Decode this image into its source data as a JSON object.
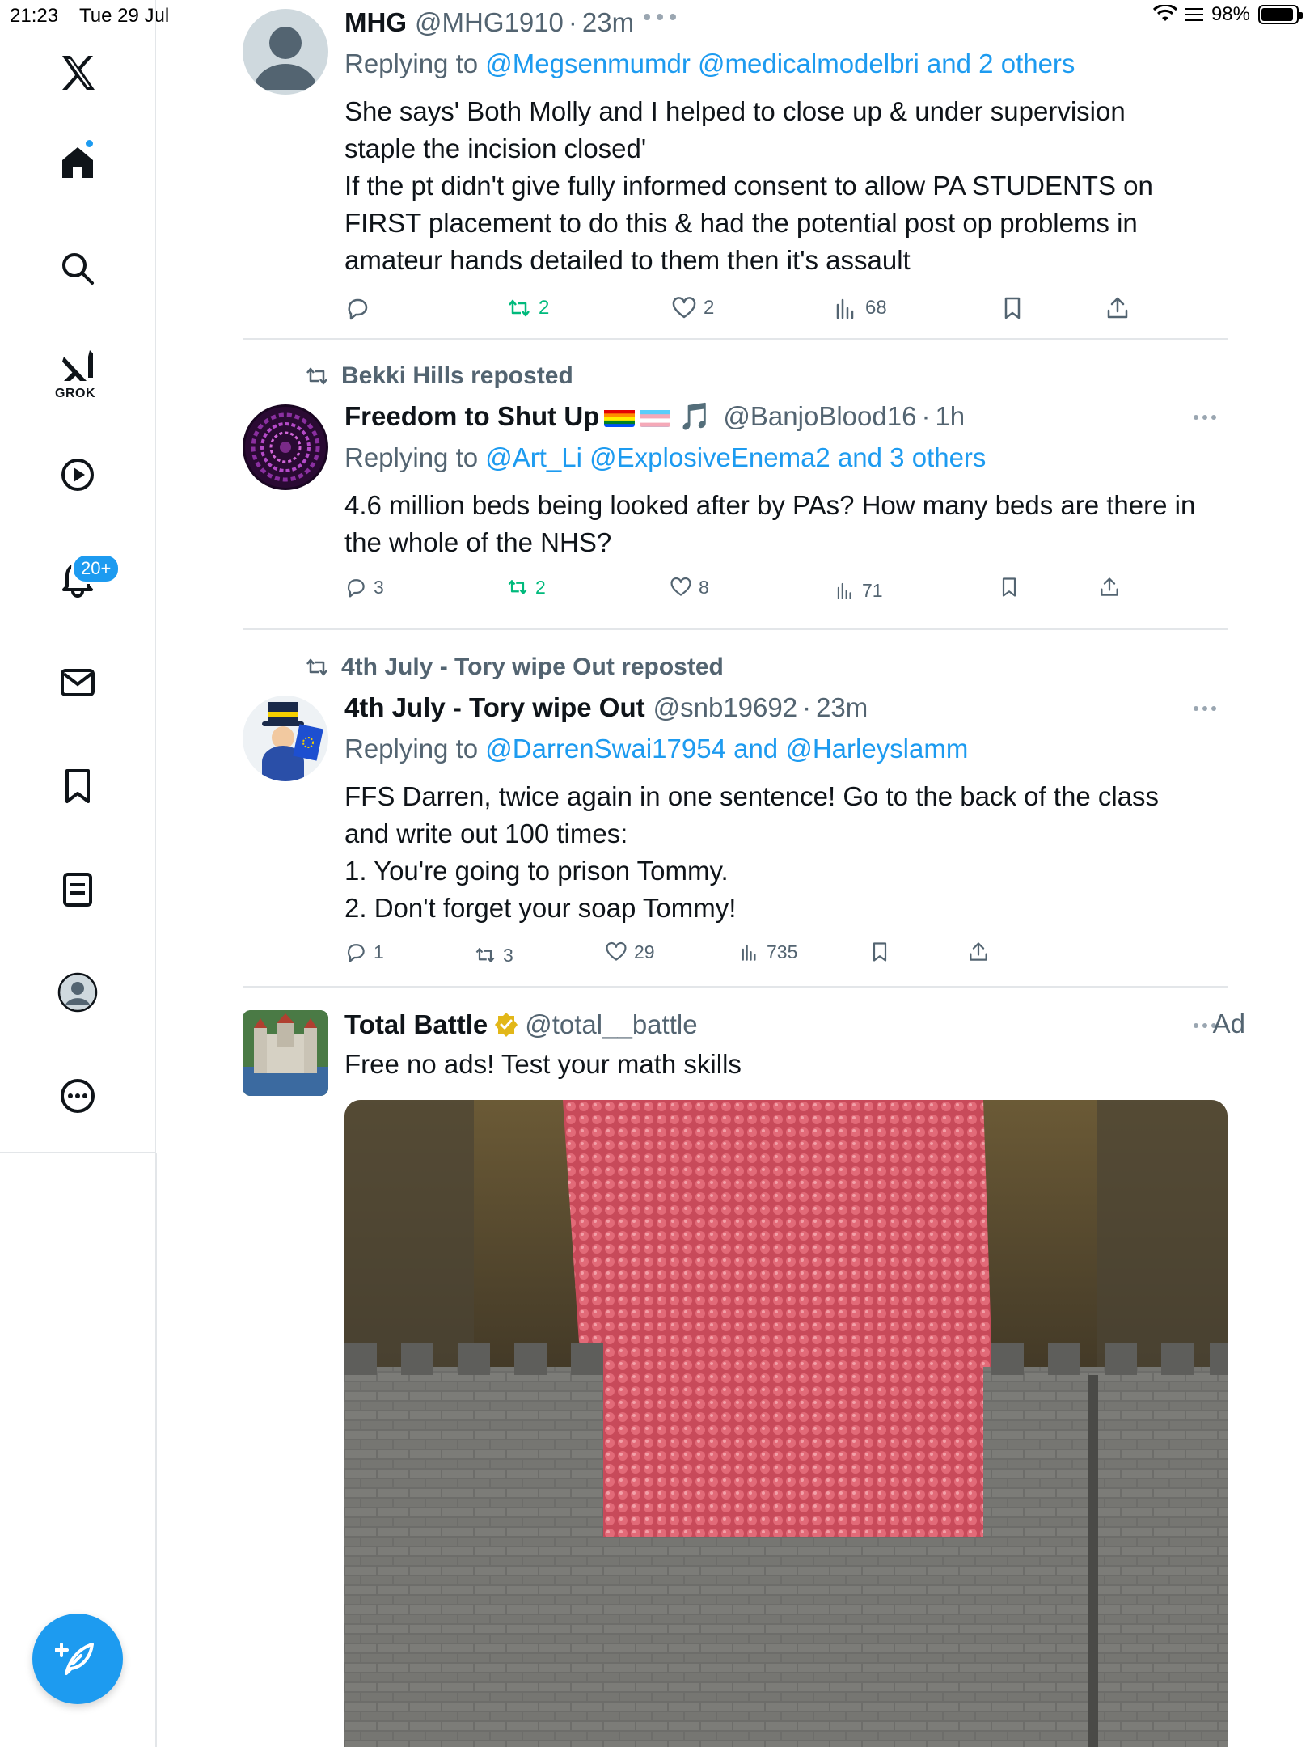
{
  "status_bar": {
    "time": "21:23",
    "date": "Tue 29 Jul",
    "battery": "98%",
    "battery_level": 0.98
  },
  "sidebar": {
    "items": [
      {
        "name": "x-logo"
      },
      {
        "name": "home",
        "has_dot": true
      },
      {
        "name": "search"
      },
      {
        "name": "grok",
        "label": "GROK"
      },
      {
        "name": "video"
      },
      {
        "name": "notifications",
        "badge": "20+"
      },
      {
        "name": "messages"
      },
      {
        "name": "bookmarks"
      },
      {
        "name": "lists"
      },
      {
        "name": "profile"
      },
      {
        "name": "more"
      }
    ],
    "compose_icon": "compose-icon"
  },
  "posts": [
    {
      "name": "MHG",
      "handle": "@MHG1910",
      "time": "23m",
      "replying_prefix": "Replying to ",
      "replying_links": "@Megsenmumdr @medicalmodelbri and 2 others",
      "text_lines": [
        "She says' Both Molly and I helped to close up & under supervision",
        "staple the incision closed'",
        "If the pt didn't give fully informed consent to allow PA STUDENTS on",
        "FIRST placement to do this & had the potential post op problems in",
        "amateur hands detailed to them then it's assault"
      ],
      "replies": "",
      "reposts": "2",
      "likes": "2",
      "views": "68"
    },
    {
      "reposted_by": "Bekki Hills reposted",
      "name": "Freedom to Shut Up",
      "name_emoji": "🎵",
      "handle": "@BanjoBlood16",
      "time": "1h",
      "replying_prefix": "Replying to ",
      "replying_links": "@Art_Li @ExplosiveEnema2 and 3 others",
      "text_lines": [
        "4.6 million beds being looked after by PAs? How many beds are there in",
        "the whole of the NHS?"
      ],
      "replies": "3",
      "reposts": "2",
      "likes": "8",
      "views": "71"
    },
    {
      "reposted_by": "4th July - Tory wipe Out reposted",
      "name": "4th July - Tory wipe Out",
      "handle": "@snb19692",
      "time": "23m",
      "replying_prefix": "Replying to ",
      "replying_links": "@DarrenSwai17954 and @Harleyslamm",
      "text_lines": [
        "FFS Darren, twice again in one sentence! Go to the back of the class",
        "and write out 100 times:",
        "1. You're going to prison Tommy.",
        "2. Don't forget your soap Tommy!"
      ],
      "replies": "1",
      "reposts": "3",
      "likes": "29",
      "views": "735"
    },
    {
      "name": "Total Battle",
      "handle": "@total__battle",
      "ad_label": "Ad",
      "text_lines": [
        "Free no ads! Test your math skills"
      ]
    }
  ],
  "colors": {
    "accent": "#1d9bf0",
    "repost_green": "#00ba7c",
    "muted": "#536471",
    "text": "#0f1419",
    "verified_gold": "#e2b719"
  }
}
